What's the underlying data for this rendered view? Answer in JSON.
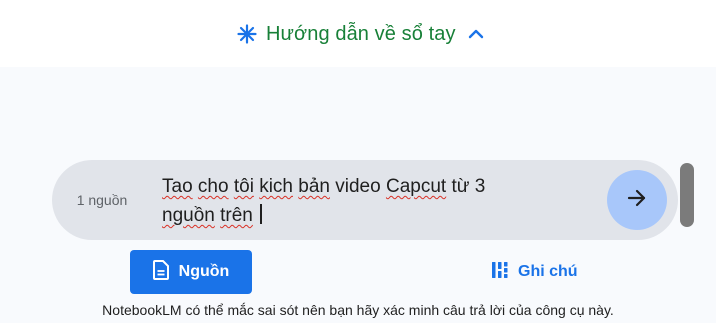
{
  "guide": {
    "label": "Hướng dẫn về sổ tay",
    "icon": "asterisk-spark-icon",
    "toggle_icon": "chevron-up-icon",
    "accent": "#188038",
    "icon_color": "#1a73e8"
  },
  "composer": {
    "source_count": "1 nguồn",
    "prompt_segments": [
      "Tao",
      " ",
      "cho",
      " ",
      "tôi",
      " ",
      "kich",
      " ",
      "bản",
      " video ",
      "Capcut",
      " từ 3\n",
      "nguồn",
      " ",
      "trên",
      " "
    ],
    "send_icon": "arrow-right-icon"
  },
  "actions": {
    "sources_label": "Nguồn",
    "sources_icon": "document-icon",
    "notes_label": "Ghi chú",
    "notes_icon": "grid-notes-icon",
    "primary_color": "#1a73e8"
  },
  "footer": {
    "disclaimer": "NotebookLM có thể mắc sai sót nên bạn hãy xác minh câu trả lời của công cụ này."
  }
}
